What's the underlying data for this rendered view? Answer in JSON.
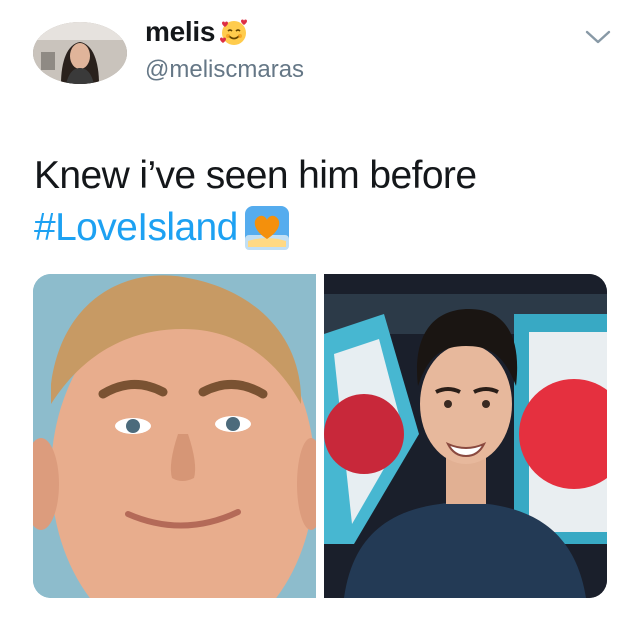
{
  "user": {
    "display_name": "melis",
    "handle": "@meliscmaras",
    "name_emoji": "smiling-face-with-hearts-icon"
  },
  "tweet": {
    "text": "Knew i’ve seen him before",
    "hashtag": "#LoveIsland",
    "hashtag_emoji": "orange-heart-on-beach-icon"
  },
  "media": {
    "left_photo": "smiling-young-man-photo",
    "right_photo": "man-speaking-on-tv-photo"
  },
  "colors": {
    "text": "#14171a",
    "secondary": "#657786",
    "link": "#1da1f2"
  }
}
